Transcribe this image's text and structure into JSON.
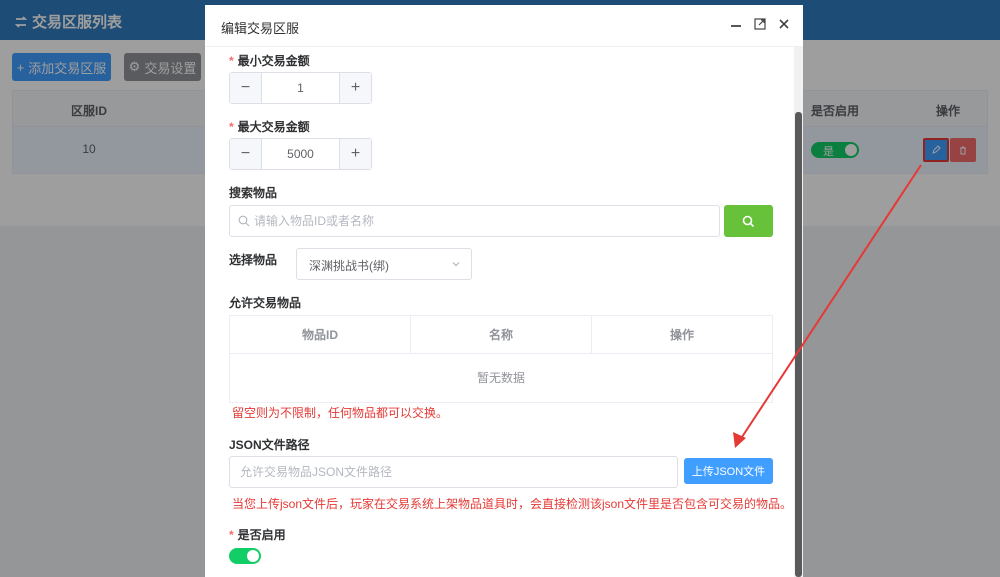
{
  "header": {
    "title": "交易区服列表"
  },
  "toolbar": {
    "add_label": "添加交易区服",
    "settings_label": "交易设置"
  },
  "table": {
    "columns": {
      "id": "区服ID",
      "enabled": "是否启用",
      "actions": "操作"
    },
    "rows": [
      {
        "id": "10",
        "enabled_label": "是"
      }
    ]
  },
  "dialog": {
    "title": "编辑交易区服",
    "min_amount": {
      "label": "最小交易金额",
      "value": "1"
    },
    "max_amount": {
      "label": "最大交易金额",
      "value": "5000"
    },
    "search": {
      "label": "搜索物品",
      "placeholder": "请输入物品ID或者名称"
    },
    "select_item": {
      "label": "选择物品",
      "value": "深渊挑战书(绑)"
    },
    "allowed_items": {
      "label": "允许交易物品",
      "columns": [
        "物品ID",
        "名称",
        "操作"
      ],
      "empty_text": "暂无数据",
      "hint": "留空则为不限制，任何物品都可以交换。"
    },
    "json_path": {
      "label": "JSON文件路径",
      "placeholder": "允许交易物品JSON文件路径",
      "upload_label": "上传JSON文件",
      "hint": "当您上传json文件后，玩家在交易系统上架物品道具时，会直接检测该json文件里是否包含可交易的物品。"
    },
    "enabled": {
      "label": "是否启用",
      "on": true
    }
  },
  "colors": {
    "primary": "#409eff",
    "success": "#67c23a",
    "switch_on": "#13ce66",
    "danger": "#f56c6c",
    "header": "#2f7bbf",
    "annotation": "#e53935"
  }
}
